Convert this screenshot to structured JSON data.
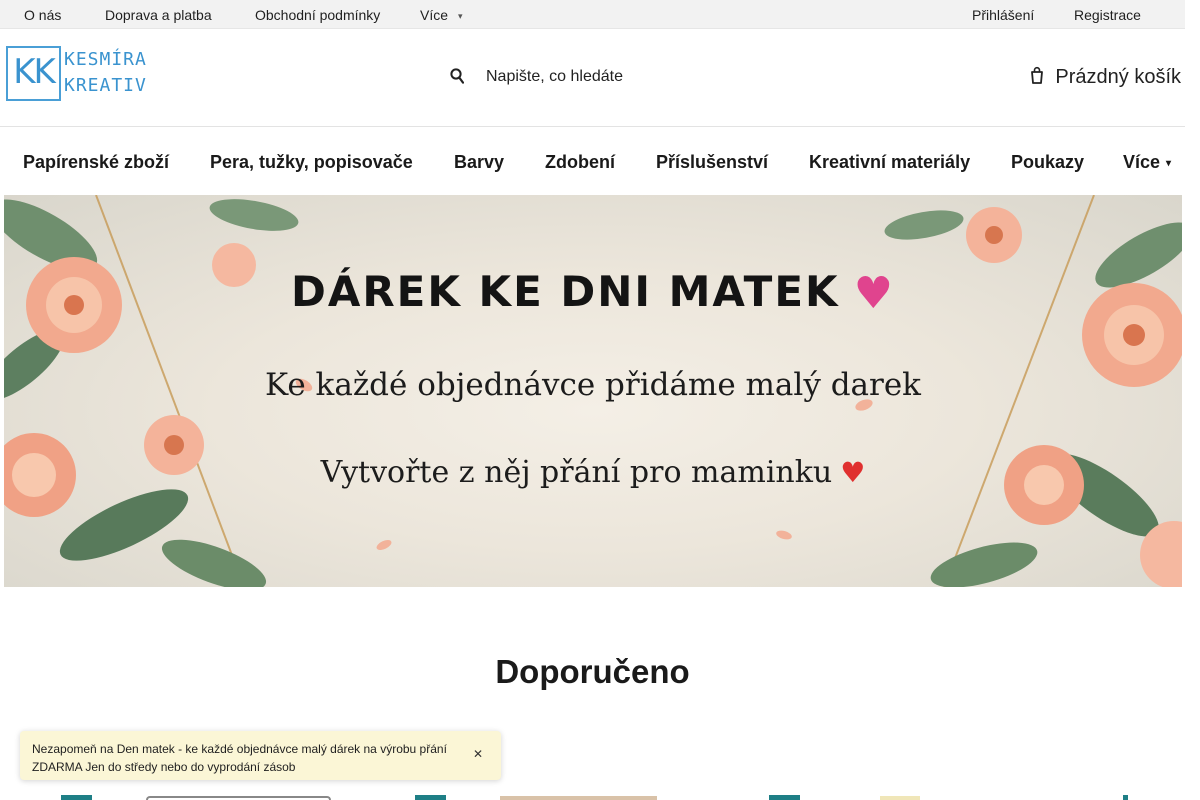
{
  "topbar": {
    "links": [
      "O nás",
      "Doprava a platba",
      "Obchodní podmínky"
    ],
    "more_label": "Více",
    "login": "Přihlášení",
    "register": "Registrace"
  },
  "header": {
    "logo_letters": "KK",
    "logo_line1": "KESMÍRA",
    "logo_line2": "KREATIV",
    "search_placeholder": "Napište, co hledáte",
    "cart_label": "Prázdný košík"
  },
  "nav": {
    "items": [
      "Papírenské zboží",
      "Pera, tužky, popisovače",
      "Barvy",
      "Zdobení",
      "Příslušenství",
      "Kreativní materiály",
      "Poukazy"
    ],
    "more_label": "Více"
  },
  "hero": {
    "headline": "DÁREK KE DNI MATEK",
    "line2": "Ke každé objednávce přidáme malý darek",
    "line3": "Vytvořte z něj přání pro maminku"
  },
  "section": {
    "title": "Doporučeno"
  },
  "notice": {
    "text": "Nezapomeň na Den matek - ke každé objednávce malý dárek na výrobu přání ZDARMA  Jen do středy nebo do vyprodání zásob"
  },
  "icons": {
    "search": "search-icon",
    "cart": "cart-icon",
    "close": "close-icon",
    "chevron": "chevron-down-icon"
  },
  "colors": {
    "logo_blue": "#3a93cf",
    "badge_teal": "#1e7f86",
    "notice_bg": "#fbf6d6",
    "topbar_bg": "#f2f2f2"
  }
}
